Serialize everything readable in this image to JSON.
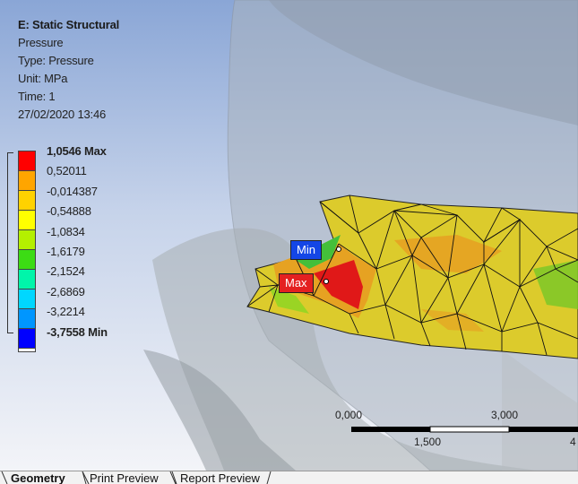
{
  "info": {
    "title": "E: Static Structural",
    "result": "Pressure",
    "type_line": "Type: Pressure",
    "unit_line": "Unit: MPa",
    "time_line": "Time: 1",
    "timestamp": "27/02/2020 13:46"
  },
  "legend": {
    "labels": [
      "1,0546 Max",
      "0,52011",
      "-0,014387",
      "-0,54888",
      "-1,0834",
      "-1,6179",
      "-2,1524",
      "-2,6869",
      "-3,2214",
      "-3,7558 Min"
    ],
    "colors": [
      "#ff0000",
      "#ffa500",
      "#ffd200",
      "#ffff00",
      "#b4f000",
      "#3cdc14",
      "#00f5aa",
      "#00d7ff",
      "#0096ff",
      "#0000ff"
    ]
  },
  "probes": {
    "min_label": "Min",
    "max_label": "Max"
  },
  "scale": {
    "ticks_top": [
      "0,000",
      "3,000"
    ],
    "ticks_bottom": [
      "1,500",
      "4"
    ]
  },
  "tabs": [
    "Geometry",
    "Print Preview",
    "Report Preview"
  ]
}
